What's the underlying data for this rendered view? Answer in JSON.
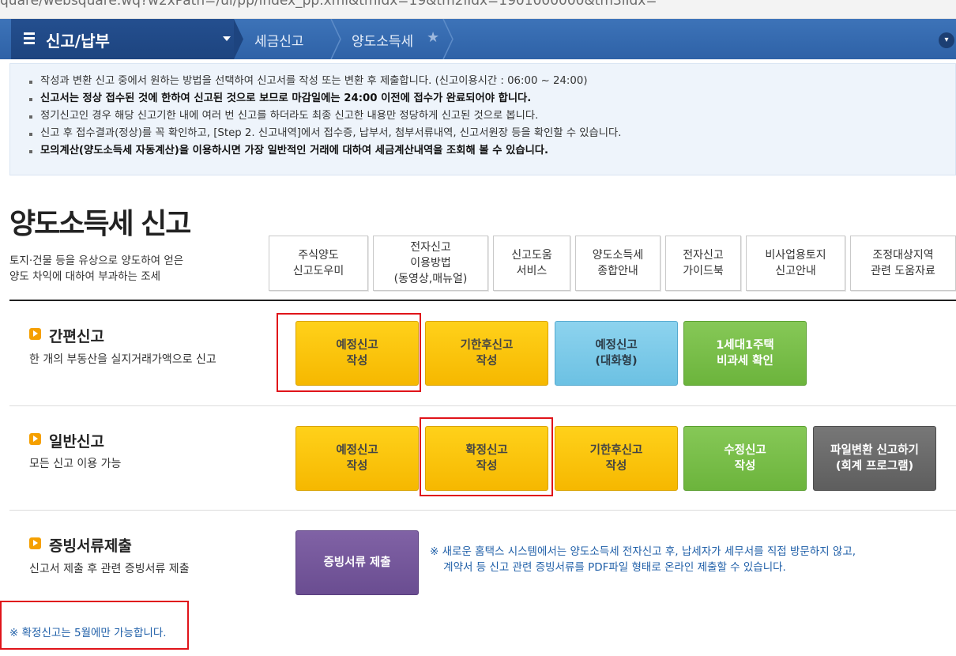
{
  "address_bar": {
    "url": "quare/websquare.wq?w2xPath=/ui/pp/index_pp.xml&tmIdx=19&tm2lIdx=1901000000&tm3lIdx="
  },
  "nav": {
    "menu_title": "신고/납부",
    "breadcrumb_1": "세금신고",
    "breadcrumb_2": "양도소득세",
    "colors": {
      "bar": "#3366ad",
      "menu": "#1f4a86"
    }
  },
  "notice": {
    "lines": [
      "작성과 변환 신고 중에서 원하는 방법을 선택하여 신고서를 작성 또는 변환 후 제출합니다. (신고이용시간 : 06:00 ~ 24:00)",
      "신고서는 정상 접수된 것에 한하여 신고된 것으로 보므로 마감일에는 24:00 이전에 접수가 완료되어야 합니다.",
      "정기신고인 경우 해당 신고기한 내에 여러 번 신고를 하더라도 최종 신고한 내용만 정당하게 신고된 것으로 봅니다.",
      "신고 후 접수결과(정상)를 꼭 확인하고, [Step 2. 신고내역]에서 접수증, 납부서, 첨부서류내역, 신고서원장 등을 확인할 수 있습니다.",
      "모의계산(양도소득세 자동계산)을 이용하시면 가장 일반적인 거래에 대하여 세금계산내역을 조회해 볼 수 있습니다."
    ]
  },
  "page": {
    "title": "양도소득세 신고",
    "desc_line1": "토지·건물 등을 유상으로 양도하여 얻은",
    "desc_line2": "양도 차익에 대하여 부과하는 조세"
  },
  "guides": [
    "주식양도\n신고도우미",
    "전자신고\n이용방법\n(동영상,매뉴얼)",
    "신고도움\n서비스",
    "양도소득세\n종합안내",
    "전자신고\n가이드북",
    "비사업용토지\n신고안내",
    "조정대상지역\n관련 도움자료"
  ],
  "simple": {
    "title": "간편신고",
    "desc": "한 개의 부동산을 실지거래가액으로 신고",
    "buttons": [
      "예정신고\n작성",
      "기한후신고\n작성",
      "예정신고\n(대화형)",
      "1세대1주택\n비과세 확인"
    ]
  },
  "general": {
    "title": "일반신고",
    "desc": "모든 신고 이용 가능",
    "buttons": [
      "예정신고\n작성",
      "확정신고\n작성",
      "기한후신고\n작성",
      "수정신고\n작성",
      "파일변환 신고하기\n(회계 프로그램)"
    ]
  },
  "evidence": {
    "title": "증빙서류제출",
    "desc": "신고서 제출 후 관련 증빙서류 제출",
    "button": "증빙서류 제출",
    "note": "※ 새로운 홈택스 시스템에서는 양도소득세 전자신고 후, 납세자가 세무서를 직접 방문하지 않고,\n    계약서 등 신고 관련 증빙서류를 PDF파일 형태로 온라인 제출할 수 있습니다."
  },
  "footer_note": "※ 확정신고는 5월에만 가능합니다.",
  "colors": {
    "highlight_border": "#e0141a",
    "accent_orange": "#f5a000",
    "link_blue": "#1f5fa8"
  }
}
